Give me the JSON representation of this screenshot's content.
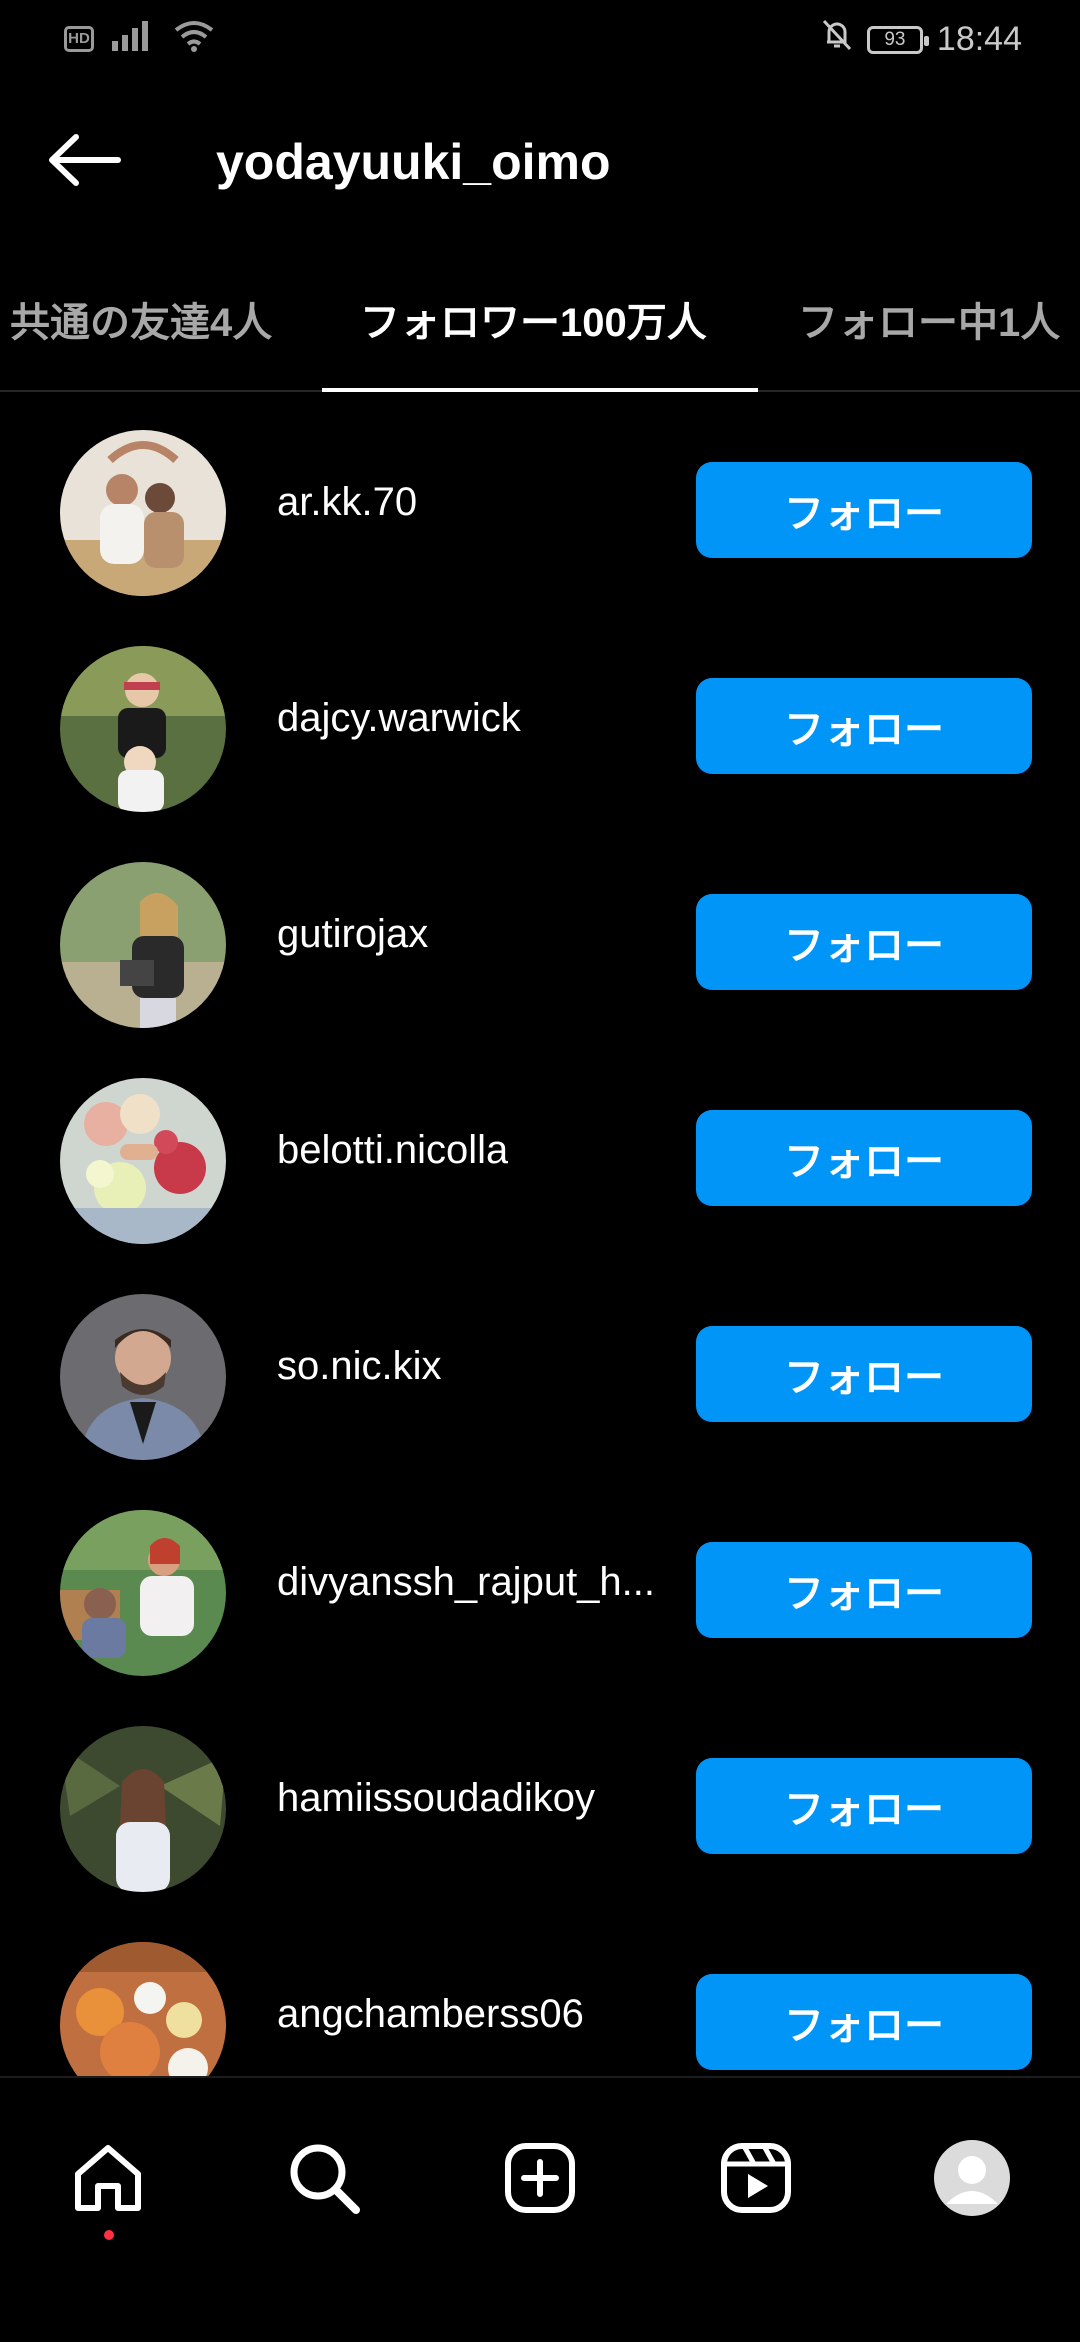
{
  "status_bar": {
    "network": "HD",
    "battery": "93",
    "time": "18:44"
  },
  "header": {
    "title": "yodayuuki_oimo"
  },
  "tabs": [
    {
      "label": "共通の友達4人"
    },
    {
      "label": "フォロワー100万人"
    },
    {
      "label": "フォロー中1人"
    }
  ],
  "followers": [
    {
      "username": "ar.kk.70",
      "button": "フォロー"
    },
    {
      "username": "dajcy.warwick",
      "button": "フォロー"
    },
    {
      "username": "gutirojax",
      "button": "フォロー"
    },
    {
      "username": "belotti.nicolla",
      "button": "フォロー"
    },
    {
      "username": "so.nic.kix",
      "button": "フォロー"
    },
    {
      "username": "divyanssh_rajput_h...",
      "button": "フォロー"
    },
    {
      "username": "hamiissoudadikoy",
      "button": "フォロー"
    },
    {
      "username": "angchamberss06",
      "button": "フォロー"
    }
  ],
  "colors": {
    "accent": "#0095f6",
    "background": "#000000",
    "notification_dot": "#ff3040"
  },
  "bottom_nav": [
    {
      "icon": "home-icon"
    },
    {
      "icon": "search-icon"
    },
    {
      "icon": "create-icon"
    },
    {
      "icon": "reels-icon"
    },
    {
      "icon": "profile-avatar"
    }
  ]
}
